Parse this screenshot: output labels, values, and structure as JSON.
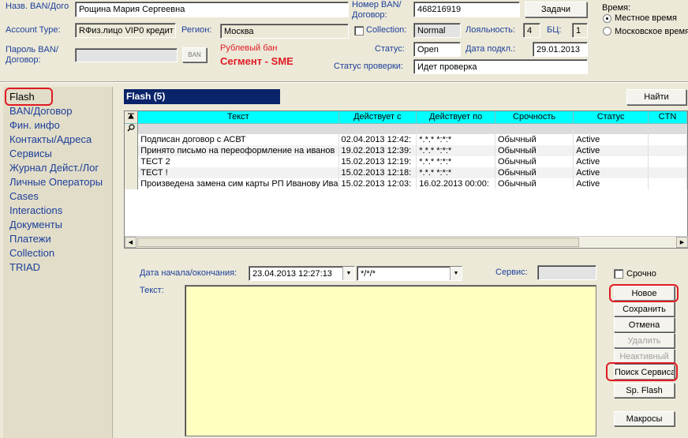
{
  "header": {
    "ban_name_label": "Назв. BAN/Дого",
    "ban_name_value": "Рощина Мария Сергеевна",
    "ban_number_label": "Номер BAN/\nДоговор:",
    "ban_number_value": "468216919",
    "tasks_button": "Задачи",
    "time_label": "Время:",
    "time_local": "Местное время",
    "time_moscow": "Московское время",
    "account_type_label": "Account Type:",
    "account_type_value": "RФиз.лицо  VIP0  кредит",
    "region_label": "Регион:",
    "region_value": "Москва",
    "collection_label": "Collection:",
    "collection_value": "Normal",
    "loyalty_label": "Лояльность:",
    "loyalty_value": "4",
    "bc_label": "БЦ:",
    "bc_value": "1",
    "password_label": "Пароль BAN/\nДоговор:",
    "ban_button": "BAN",
    "ruble_ban": "Рублевый бан",
    "segment": "Сегмент - SME",
    "status_label": "Статус:",
    "status_value": "Open",
    "connect_date_label": "Дата подкл.:",
    "connect_date_value": "29.01.2013",
    "check_status_label": "Статус проверки:",
    "check_status_value": "Идет проверка"
  },
  "sidebar": {
    "items": [
      "Flash",
      "BAN/Договор",
      "Фин. инфо",
      "Контакты/Адреса",
      "Сервисы",
      "Журнал Дейст./Лог",
      "Личные Операторы",
      "Cases",
      "Interactions",
      "Документы",
      "Платежи",
      "Collection",
      "TRIAD"
    ]
  },
  "flash": {
    "title": "Flash (5)",
    "find_button": "Найти",
    "columns": [
      "Текст",
      "Действует с",
      "Действует по",
      "Срочность",
      "Статус",
      "CTN"
    ],
    "rows": [
      [
        "Подписан договор с АСВТ",
        "02.04.2013 12:42:",
        "*.*.* *:*:*",
        "Обычный",
        "Active",
        ""
      ],
      [
        "Принято письмо на переоформление на иванов",
        "19.02.2013 12:39:",
        "*.*.* *:*:*",
        "Обычный",
        "Active",
        ""
      ],
      [
        "ТЕСТ 2",
        "15.02.2013 12:19:",
        "*.*.* *:*:*",
        "Обычный",
        "Active",
        ""
      ],
      [
        "ТЕСТ !",
        "15.02.2013 12:18:",
        "*.*.* *:*:*",
        "Обычный",
        "Active",
        ""
      ],
      [
        "Произведена замена сим карты РП Иванову Ива",
        "15.02.2013 12:03:",
        "16.02.2013 00:00:",
        "Обычный",
        "Active",
        ""
      ]
    ]
  },
  "form": {
    "date_label": "Дата начала/окончания:",
    "date_start": "23.04.2013 12:27:13",
    "date_end": "*/*/*",
    "service_label": "Сервис:",
    "text_label": "Текст:",
    "urgent_label": "Срочно",
    "buttons": {
      "new": "Новое",
      "save": "Сохранить",
      "cancel": "Отмена",
      "delete": "Удалить",
      "inactive": "Неактивный",
      "search_service": "Поиск Сервиса",
      "sp_flash": "Sp. Flash",
      "macros": "Макросы"
    }
  },
  "colors": {
    "accent_red": "#e01b24",
    "label_blue": "#1c3f9b",
    "title_bar": "#0a246a",
    "grid_header": "#00ffff",
    "note_yellow": "#ffffc0"
  }
}
